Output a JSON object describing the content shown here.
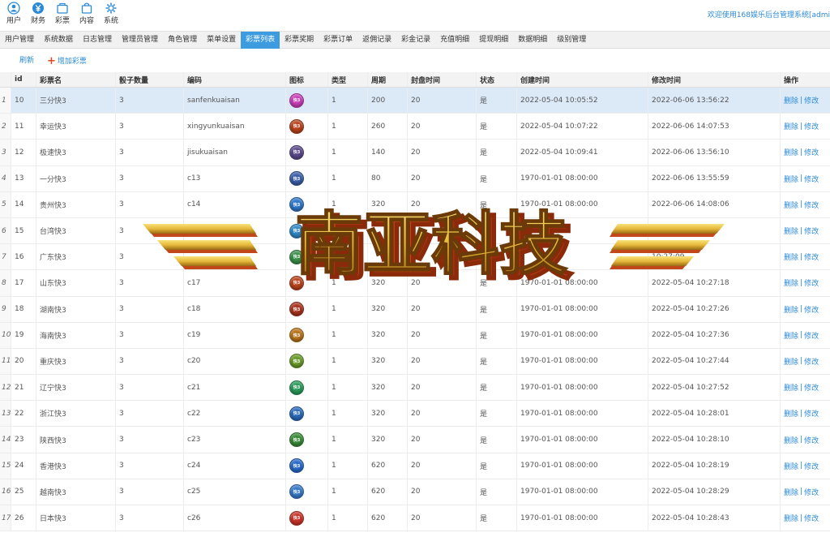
{
  "topnav": [
    {
      "label": "用户",
      "icon": "user-icon"
    },
    {
      "label": "财务",
      "icon": "yen-icon"
    },
    {
      "label": "彩票",
      "icon": "ticket-icon"
    },
    {
      "label": "内容",
      "icon": "bag-icon"
    },
    {
      "label": "系统",
      "icon": "gear-icon"
    }
  ],
  "welcome_text": "欢迎使用168娱乐后台管理系统[admi",
  "tabs": [
    "用户管理",
    "系统数据",
    "日志管理",
    "管理员管理",
    "角色管理",
    "菜单设置",
    "彩票列表",
    "彩票奖期",
    "彩票订单",
    "返佣记录",
    "彩金记录",
    "充值明细",
    "提现明细",
    "数据明细",
    "级别管理"
  ],
  "active_tab": 6,
  "toolbar": {
    "refresh_label": "刷新",
    "add_label": "增加彩票"
  },
  "columns": {
    "id": "id",
    "name": "彩票名",
    "dice": "骰子数量",
    "code": "编码",
    "icon": "图标",
    "type": "类型",
    "period": "周期",
    "seal": "封盘时间",
    "status": "状态",
    "created": "创建时间",
    "modified": "修改时间",
    "ops": "操作"
  },
  "row_actions": {
    "delete": "删除",
    "sep": "|",
    "edit": "修改"
  },
  "rows": [
    {
      "n": "1",
      "id": "10",
      "name": "三分快3",
      "dice": "3",
      "code": "sanfenkuaisan",
      "type": "1",
      "period": "200",
      "seal": "20",
      "status": "是",
      "created": "2022-05-04 10:05:52",
      "modified": "2022-06-06 13:56:22",
      "icon_color": "#c93fb8"
    },
    {
      "n": "2",
      "id": "11",
      "name": "幸运快3",
      "dice": "3",
      "code": "xingyunkuaisan",
      "type": "1",
      "period": "260",
      "seal": "20",
      "status": "是",
      "created": "2022-05-04 10:07:22",
      "modified": "2022-06-06 14:07:53",
      "icon_color": "#b8421c"
    },
    {
      "n": "3",
      "id": "12",
      "name": "极速快3",
      "dice": "3",
      "code": "jisukuaisan",
      "type": "1",
      "period": "140",
      "seal": "20",
      "status": "是",
      "created": "2022-05-04 10:09:41",
      "modified": "2022-06-06 13:56:10",
      "icon_color": "#5a4a8a"
    },
    {
      "n": "4",
      "id": "13",
      "name": "一分快3",
      "dice": "3",
      "code": "c13",
      "type": "1",
      "period": "80",
      "seal": "20",
      "status": "是",
      "created": "1970-01-01 08:00:00",
      "modified": "2022-06-06 13:55:59",
      "icon_color": "#3a5fa8"
    },
    {
      "n": "5",
      "id": "14",
      "name": "贵州快3",
      "dice": "3",
      "code": "c14",
      "type": "1",
      "period": "320",
      "seal": "20",
      "status": "是",
      "created": "1970-01-01 08:00:00",
      "modified": "2022-06-06 14:08:06",
      "icon_color": "#2f78c8"
    },
    {
      "n": "6",
      "id": "15",
      "name": "台湾快3",
      "dice": "3",
      "code": "",
      "type": "",
      "period": "",
      "seal": "",
      "status": "",
      "created": "197",
      "modified": "",
      "icon_color": "#2d86c4"
    },
    {
      "n": "7",
      "id": "16",
      "name": "广东快3",
      "dice": "3",
      "code": "",
      "type": "",
      "period": "",
      "seal": "",
      "status": "",
      "created": "",
      "modified": "10:27:09",
      "icon_color": "#3a8f4a"
    },
    {
      "n": "8",
      "id": "17",
      "name": "山东快3",
      "dice": "3",
      "code": "c17",
      "type": "1",
      "period": "320",
      "seal": "20",
      "status": "是",
      "created": "1970-01-01 08:00:00",
      "modified": "2022-05-04 10:27:18",
      "icon_color": "#b8421c"
    },
    {
      "n": "9",
      "id": "18",
      "name": "湖南快3",
      "dice": "3",
      "code": "c18",
      "type": "1",
      "period": "320",
      "seal": "20",
      "status": "是",
      "created": "1970-01-01 08:00:00",
      "modified": "2022-05-04 10:27:26",
      "icon_color": "#a8341f"
    },
    {
      "n": "10",
      "id": "19",
      "name": "海南快3",
      "dice": "3",
      "code": "c19",
      "type": "1",
      "period": "320",
      "seal": "20",
      "status": "是",
      "created": "1970-01-01 08:00:00",
      "modified": "2022-05-04 10:27:36",
      "icon_color": "#b8741c"
    },
    {
      "n": "11",
      "id": "20",
      "name": "重庆快3",
      "dice": "3",
      "code": "c20",
      "type": "1",
      "period": "320",
      "seal": "20",
      "status": "是",
      "created": "1970-01-01 08:00:00",
      "modified": "2022-05-04 10:27:44",
      "icon_color": "#6a9a2a"
    },
    {
      "n": "12",
      "id": "21",
      "name": "辽宁快3",
      "dice": "3",
      "code": "c21",
      "type": "1",
      "period": "320",
      "seal": "20",
      "status": "是",
      "created": "1970-01-01 08:00:00",
      "modified": "2022-05-04 10:27:52",
      "icon_color": "#2a9a5a"
    },
    {
      "n": "13",
      "id": "22",
      "name": "浙江快3",
      "dice": "3",
      "code": "c22",
      "type": "1",
      "period": "320",
      "seal": "20",
      "status": "是",
      "created": "1970-01-01 08:00:00",
      "modified": "2022-05-04 10:28:01",
      "icon_color": "#2a6ab8"
    },
    {
      "n": "14",
      "id": "23",
      "name": "陕西快3",
      "dice": "3",
      "code": "c23",
      "type": "1",
      "period": "320",
      "seal": "20",
      "status": "是",
      "created": "1970-01-01 08:00:00",
      "modified": "2022-05-04 10:28:10",
      "icon_color": "#3a8a3a"
    },
    {
      "n": "15",
      "id": "24",
      "name": "香港快3",
      "dice": "3",
      "code": "c24",
      "type": "1",
      "period": "620",
      "seal": "20",
      "status": "是",
      "created": "1970-01-01 08:00:00",
      "modified": "2022-05-04 10:28:19",
      "icon_color": "#2a6ac8"
    },
    {
      "n": "16",
      "id": "25",
      "name": "越南快3",
      "dice": "3",
      "code": "c25",
      "type": "1",
      "period": "620",
      "seal": "20",
      "status": "是",
      "created": "1970-01-01 08:00:00",
      "modified": "2022-05-04 10:28:29",
      "icon_color": "#3a7ac8"
    },
    {
      "n": "17",
      "id": "26",
      "name": "日本快3",
      "dice": "3",
      "code": "c26",
      "type": "1",
      "period": "620",
      "seal": "20",
      "status": "是",
      "created": "1970-01-01 08:00:00",
      "modified": "2022-05-04 10:28:43",
      "icon_color": "#c8342a"
    }
  ],
  "icon_badge_text": "快3",
  "watermark": {
    "text": "南亚科技",
    "colors": {
      "gold": "#e6b93a",
      "shadow": "#c2481a"
    }
  },
  "colors": {
    "accent": "#3d9be0",
    "link": "#2a8ad8",
    "selected_row": "#dceaf8",
    "add_plus": "#e14a1f"
  }
}
